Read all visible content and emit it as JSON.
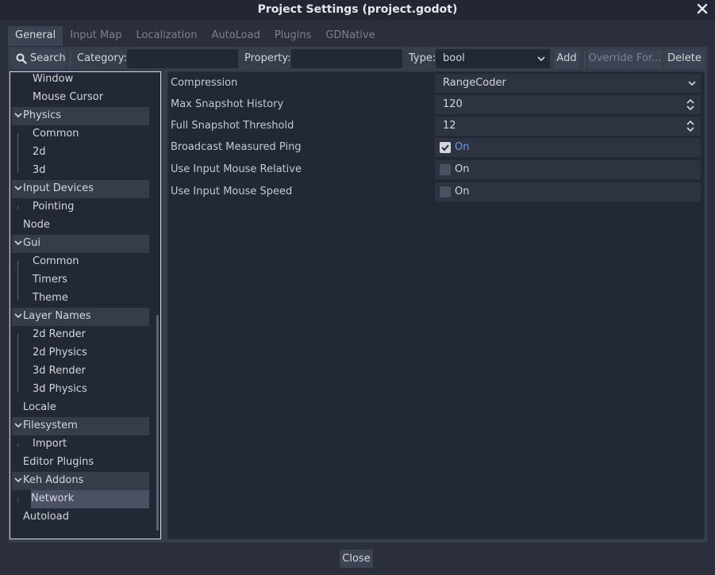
{
  "window": {
    "title": "Project Settings (project.godot)"
  },
  "tabs": [
    {
      "label": "General",
      "active": true
    },
    {
      "label": "Input Map",
      "active": false
    },
    {
      "label": "Localization",
      "active": false
    },
    {
      "label": "AutoLoad",
      "active": false
    },
    {
      "label": "Plugins",
      "active": false
    },
    {
      "label": "GDNative",
      "active": false
    }
  ],
  "toolbar": {
    "search_label": "Search",
    "category_label": "Category:",
    "category_value": "",
    "property_label": "Property:",
    "property_value": "",
    "type_label": "Type:",
    "type_value": "bool",
    "add_label": "Add",
    "override_label": "Override For...",
    "delete_label": "Delete"
  },
  "tree": [
    {
      "label": "Window",
      "level": 2
    },
    {
      "label": "Mouse Cursor",
      "level": 2
    },
    {
      "label": "Physics",
      "level": 1,
      "expanded": true
    },
    {
      "label": "Common",
      "level": 2
    },
    {
      "label": "2d",
      "level": 2
    },
    {
      "label": "3d",
      "level": 2
    },
    {
      "label": "Input Devices",
      "level": 1,
      "expanded": true
    },
    {
      "label": "Pointing",
      "level": 2
    },
    {
      "label": "Node",
      "level": 1
    },
    {
      "label": "Gui",
      "level": 1,
      "expanded": true
    },
    {
      "label": "Common",
      "level": 2
    },
    {
      "label": "Timers",
      "level": 2
    },
    {
      "label": "Theme",
      "level": 2
    },
    {
      "label": "Layer Names",
      "level": 1,
      "expanded": true
    },
    {
      "label": "2d Render",
      "level": 2
    },
    {
      "label": "2d Physics",
      "level": 2
    },
    {
      "label": "3d Render",
      "level": 2
    },
    {
      "label": "3d Physics",
      "level": 2
    },
    {
      "label": "Locale",
      "level": 1
    },
    {
      "label": "Filesystem",
      "level": 1,
      "expanded": true
    },
    {
      "label": "Import",
      "level": 2
    },
    {
      "label": "Editor Plugins",
      "level": 1
    },
    {
      "label": "Keh Addons",
      "level": 1,
      "expanded": true
    },
    {
      "label": "Network",
      "level": 2,
      "selected": true
    },
    {
      "label": "Autoload",
      "level": 1
    }
  ],
  "properties": {
    "compression": {
      "label": "Compression",
      "value": "RangeCoder"
    },
    "max_snapshot_history": {
      "label": "Max Snapshot History",
      "value": "120"
    },
    "full_snapshot_threshold": {
      "label": "Full Snapshot Threshold",
      "value": "12"
    },
    "broadcast_measured_ping": {
      "label": "Broadcast Measured Ping",
      "value": "On",
      "checked": true
    },
    "use_input_mouse_relative": {
      "label": "Use Input Mouse Relative",
      "value": "On",
      "checked": false
    },
    "use_input_mouse_speed": {
      "label": "Use Input Mouse Speed",
      "value": "On",
      "checked": false
    }
  },
  "footer": {
    "close_label": "Close"
  },
  "colors": {
    "accent": "#6e9be3",
    "background": "#2a2f3b",
    "panel": "#232835"
  },
  "icons": [
    "close-icon",
    "search-icon",
    "chevron-down-icon",
    "spinner-icon",
    "checkmark-icon"
  ]
}
